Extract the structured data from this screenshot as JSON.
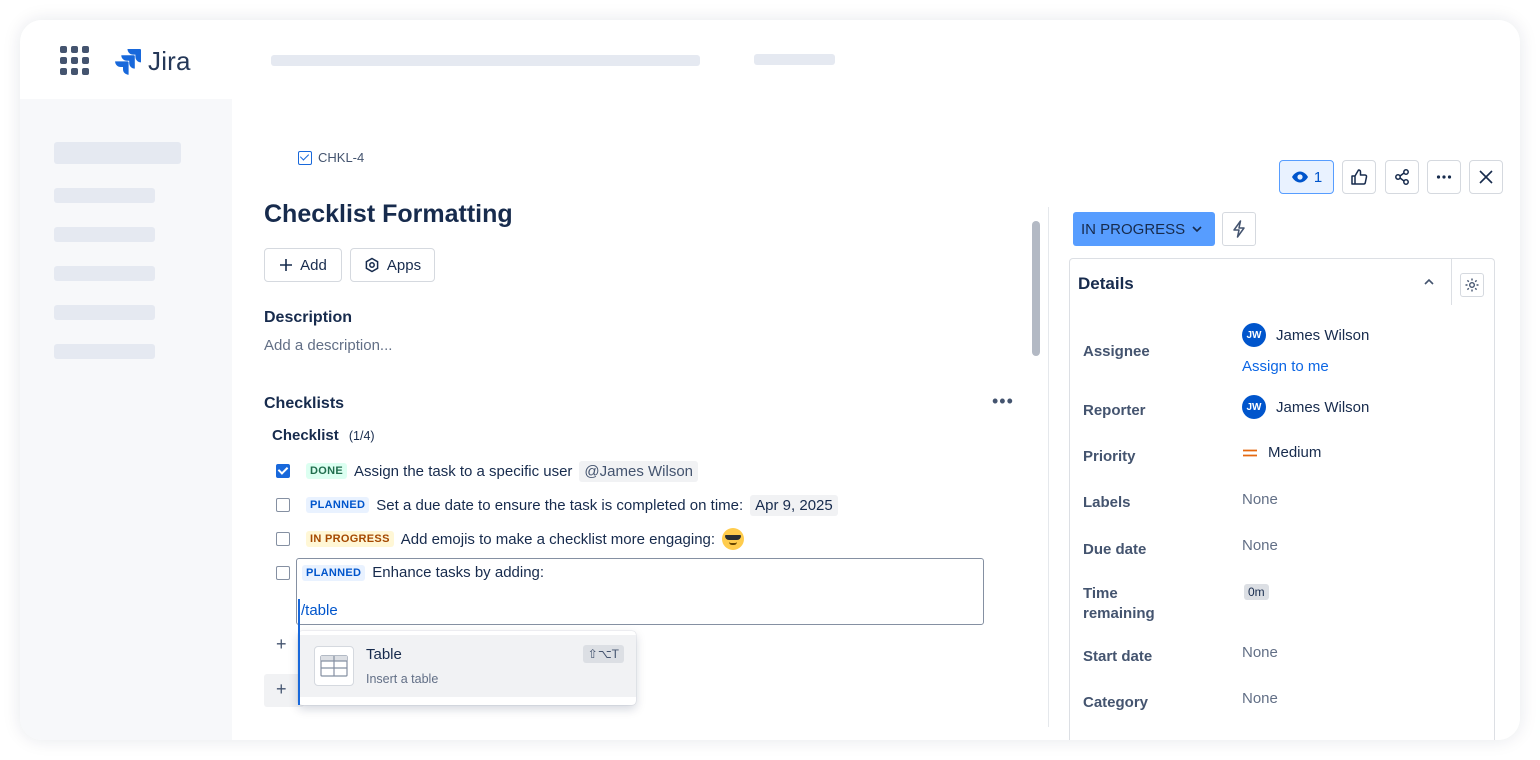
{
  "app": {
    "name": "Jira"
  },
  "issue": {
    "key": "CHKL-4",
    "title": "Checklist Formatting",
    "buttons": {
      "add": "Add",
      "apps": "Apps"
    }
  },
  "description": {
    "heading": "Description",
    "placeholder": "Add a description..."
  },
  "checklists": {
    "heading": "Checklists",
    "checklist_name": "Checklist",
    "progress": "(1/4)",
    "items": [
      {
        "checked": true,
        "status": "DONE",
        "text": "Assign the task to a specific user",
        "chip": "@James Wilson"
      },
      {
        "checked": false,
        "status": "PLANNED",
        "text": "Set a due date to ensure the task is completed on time:",
        "chip": "Apr 9, 2025"
      },
      {
        "checked": false,
        "status": "IN PROGRESS",
        "text": "Add emojis to make a checklist more engaging:"
      },
      {
        "checked": false,
        "status": "PLANNED",
        "text": "Enhance tasks by adding:"
      }
    ],
    "editor_text": "/table",
    "add_plus": "+",
    "add_bar_plus": "+"
  },
  "slash_menu": {
    "items": [
      {
        "title": "Table",
        "subtitle": "Insert a table",
        "shortcut": "⇧⌥T"
      }
    ]
  },
  "toolbar": {
    "watch_count": "1"
  },
  "status": {
    "label": "IN PROGRESS"
  },
  "details": {
    "heading": "Details",
    "assignee_label": "Assignee",
    "assignee_name": "James Wilson",
    "assignee_initials": "JW",
    "assign_to_me": "Assign to me",
    "reporter_label": "Reporter",
    "reporter_name": "James Wilson",
    "reporter_initials": "JW",
    "priority_label": "Priority",
    "priority_value": "Medium",
    "labels_label": "Labels",
    "labels_value": "None",
    "due_label": "Due date",
    "due_value": "None",
    "time_label_1": "Time",
    "time_label_2": "remaining",
    "time_value": "0m",
    "start_label": "Start date",
    "start_value": "None",
    "category_label": "Category",
    "category_value": "None"
  },
  "colors": {
    "brand_blue": "#1868db",
    "status_blue": "#579dff",
    "done_green": "#216e4e",
    "progress_orange": "#a54800",
    "priority_medium": "#e56910"
  }
}
